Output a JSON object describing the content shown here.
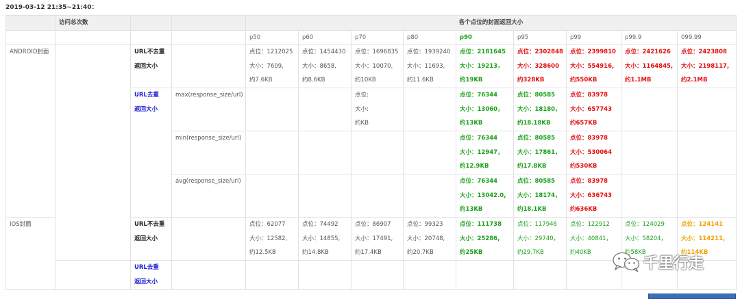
{
  "page": {
    "title": "2019-03-12 21:35~21:40："
  },
  "header": {
    "total_visits": "访问总次数",
    "group_title": "各个点位的封面返回大小",
    "percentiles": [
      "p50",
      "p60",
      "p70",
      "p80",
      "p90",
      "p95",
      "p99",
      "p99.9",
      "099.99"
    ]
  },
  "rows": [
    {
      "platform": "ANDROID封面",
      "label": [
        "URL不去重",
        "返回大小"
      ],
      "metric": "",
      "cells": [
        [
          "点位：1212025",
          "大小：7609,",
          "约7.6KB"
        ],
        [
          "点位：1454430",
          "大小：8658,",
          "约8.6KB"
        ],
        [
          "点位：1696835",
          "大小：10070,",
          "约10KB"
        ],
        [
          "点位：1939240",
          "大小：11693,",
          "约11.6KB"
        ],
        [
          "点位：2181645",
          "大小：19213，",
          "约19KB"
        ],
        [
          "点位：2302848",
          "大小：328600",
          "约328KB"
        ],
        [
          "点位：2399810",
          "大小：554916,",
          "约550KB"
        ],
        [
          "点位：2421626",
          "大小：1164845,",
          "约1.1MB"
        ],
        [
          "点位：2423808",
          "大小：2198117,",
          "约2.1MB"
        ]
      ]
    },
    {
      "platform": "",
      "label": [
        "URL去重",
        "返回大小"
      ],
      "metric": "max(response_size/url)",
      "cells": [
        [],
        [],
        [
          "点位:",
          "大小:",
          "约KB"
        ],
        [],
        [
          "点位：76344",
          "大小：13060，",
          "约13KB"
        ],
        [
          "点位：80585",
          "大小：18180，",
          "约18.18KB"
        ],
        [
          "点位：83978",
          "大小：657743",
          "约657KB"
        ],
        [],
        []
      ]
    },
    {
      "platform": "",
      "label": [],
      "metric": "min(response_size/url)",
      "cells": [
        [],
        [],
        [],
        [],
        [
          "点位：76344",
          "大小：12947，",
          "约12.9KB"
        ],
        [
          "点位：80585",
          "大小：17861，",
          "约17.8KB"
        ],
        [
          "点位：83978",
          "大小：530064",
          "约530KB"
        ],
        [],
        []
      ]
    },
    {
      "platform": "",
      "label": [],
      "metric": "avg(response_size/url)",
      "cells": [
        [],
        [],
        [],
        [],
        [
          "点位：76344",
          "大小：13042.0,",
          "约13KB"
        ],
        [
          "点位：80585",
          "大小：18174，",
          "约18.1KB"
        ],
        [
          "点位：83978",
          "大小：636743",
          "约636KB"
        ],
        [],
        []
      ]
    },
    {
      "platform": "IOS封面",
      "label": [
        "URL不去重",
        "返回大小"
      ],
      "metric": "",
      "cells": [
        [
          "点位：62077",
          "大小：12582,",
          "约12.5KB"
        ],
        [
          "点位：74492",
          "大小：14855,",
          "约14.8KB"
        ],
        [
          "点位：86907",
          "大小：17491,",
          "约17.4KB"
        ],
        [
          "点位：99323",
          "大小：20748,",
          "约20.7KB"
        ],
        [
          "点位：111738",
          "大小：25286,",
          "约25KB"
        ],
        [
          "点位：117946",
          "大小：29740，",
          "约29.7KB"
        ],
        [
          "点位：122912",
          "大小：40841，",
          "约40KB"
        ],
        [
          "点位：124029",
          "大小：58204，",
          "约58KB"
        ],
        [
          "点位：124141",
          "大小：114211,",
          "约114KB"
        ]
      ]
    },
    {
      "platform": "",
      "label": [
        "URL去重",
        "返回大小"
      ],
      "metric": "",
      "cells": [
        [],
        [],
        [],
        [],
        [],
        [],
        [],
        [],
        []
      ]
    }
  ],
  "watermark": {
    "text": "千里行走",
    "icon": "wechat-icon"
  },
  "colors": {
    "green": "#1aa01a",
    "red": "#e30f0f",
    "orange": "#f0a000",
    "blue_label": "#1a1ad4"
  }
}
